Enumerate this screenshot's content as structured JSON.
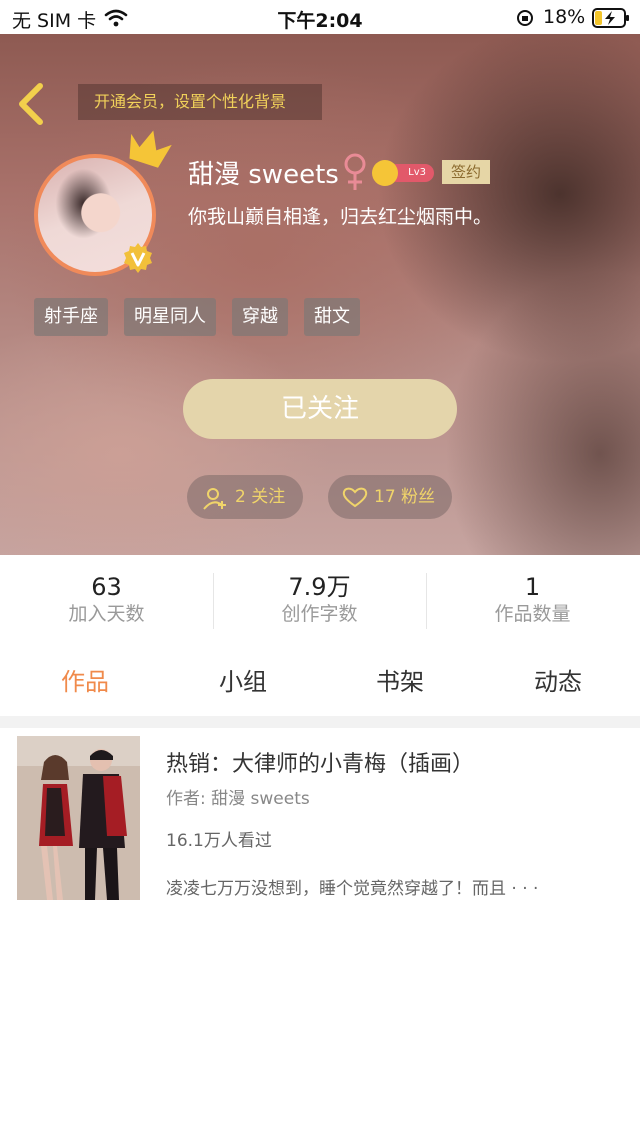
{
  "status_bar": {
    "carrier": "无 SIM 卡",
    "time": "下午2:04",
    "battery": "18%"
  },
  "header": {
    "member_banner": "开通会员，设置个性化背景",
    "username": "甜漫 sweets",
    "gender_symbol": "♀",
    "level": "Lv3",
    "sign_badge": "签约",
    "bio": "你我山巅自相逢，归去红尘烟雨中。",
    "tags": [
      "射手座",
      "明星同人",
      "穿越",
      "甜文"
    ],
    "follow_button": "已关注",
    "following": "2 关注",
    "fans": "17 粉丝"
  },
  "stats": [
    {
      "value": "63",
      "label": "加入天数"
    },
    {
      "value": "7.9万",
      "label": "创作字数"
    },
    {
      "value": "1",
      "label": "作品数量"
    }
  ],
  "tabs": [
    "作品",
    "小组",
    "书架",
    "动态"
  ],
  "active_tab": "作品",
  "works": [
    {
      "title": "热销：大律师的小青梅（插画）",
      "author": "作者: 甜漫 sweets",
      "views": "16.1万人看过",
      "excerpt": "凌凌七万万没想到，睡个觉竟然穿越了！而且 · · ·"
    }
  ],
  "colors": {
    "accent": "#f08a4b",
    "gold": "#f0d46a",
    "follow_button": "#e4d5ab",
    "avatar_border": "#f08a5a"
  },
  "icons": [
    "back-chevron-icon",
    "crown-icon",
    "vip-v-icon",
    "female-icon",
    "add-user-icon",
    "heart-icon",
    "wifi-icon",
    "battery-charging-icon",
    "rotation-lock-icon"
  ]
}
